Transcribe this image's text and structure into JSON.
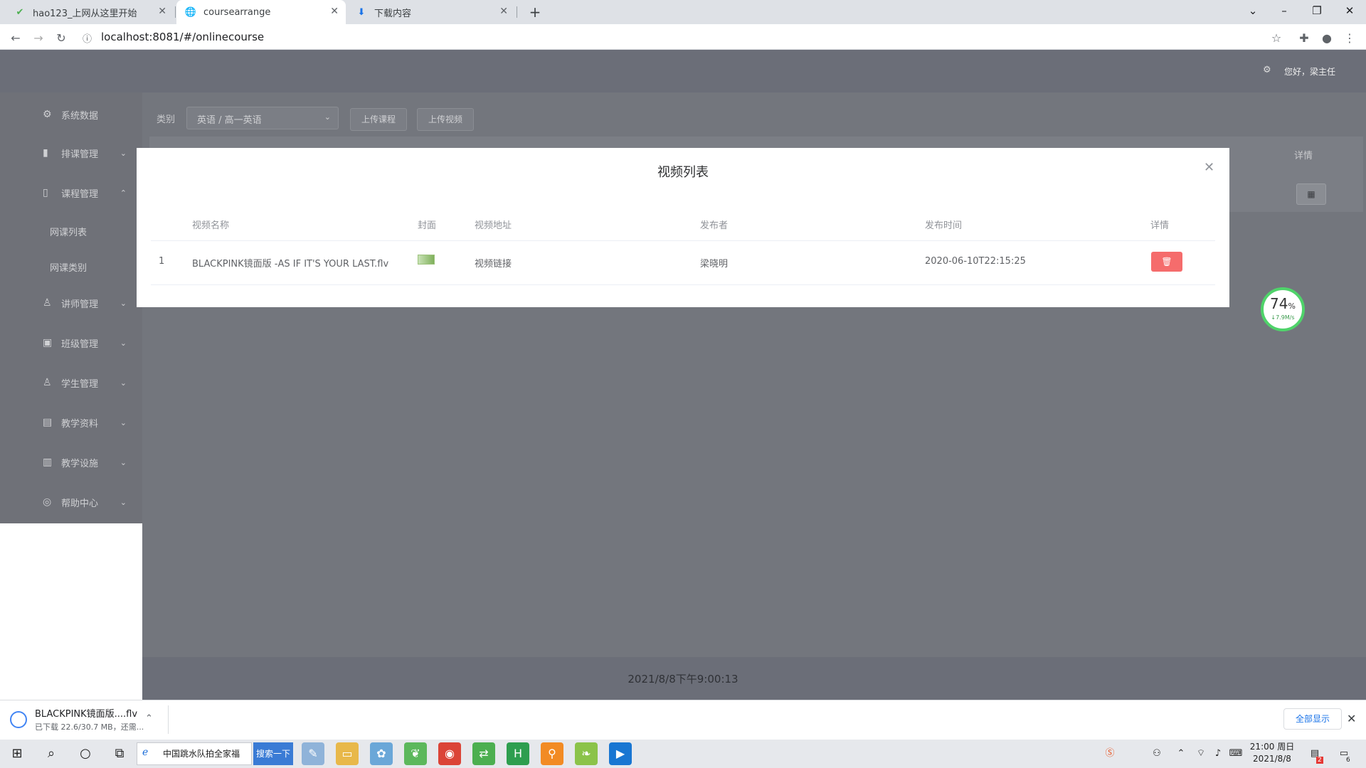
{
  "browser": {
    "tabs": [
      {
        "title": "hao123_上网从这里开始",
        "icon": "hao123-icon"
      },
      {
        "title": "coursearrange",
        "icon": "globe-icon"
      },
      {
        "title": "下载内容",
        "icon": "download-icon"
      }
    ],
    "url": "localhost:8081/#/onlinecourse"
  },
  "header": {
    "greeting": "您好，梁主任"
  },
  "sidebar": {
    "items": [
      {
        "label": "系统数据",
        "icon": "gear-icon"
      },
      {
        "label": "排课管理",
        "icon": "bar-chart-icon"
      },
      {
        "label": "课程管理",
        "icon": "book-icon"
      },
      {
        "label": "讲师管理",
        "icon": "user-icon"
      },
      {
        "label": "班级管理",
        "icon": "briefcase-icon"
      },
      {
        "label": "学生管理",
        "icon": "user-icon"
      },
      {
        "label": "教学资料",
        "icon": "document-icon"
      },
      {
        "label": "教学设施",
        "icon": "building-icon"
      },
      {
        "label": "帮助中心",
        "icon": "help-icon"
      }
    ],
    "sub_items": [
      {
        "label": "网课列表"
      },
      {
        "label": "网课类别"
      }
    ]
  },
  "toolbar": {
    "category_label": "类别",
    "category_value": "英语 / 高一英语",
    "upload_course": "上传课程",
    "upload_video": "上传视频"
  },
  "bg_table": {
    "detail_header": "详情"
  },
  "modal": {
    "title": "视频列表",
    "columns": [
      "视频名称",
      "封面",
      "视频地址",
      "发布者",
      "发布时间",
      "详情"
    ],
    "rows": [
      {
        "index": "1",
        "name": "BLACKPINK镜面版 -AS IF IT'S YOUR LAST.flv",
        "link": "视频链接",
        "publisher": "梁晓明",
        "time": "2020-06-10T22:15:25"
      }
    ]
  },
  "speed_widget": {
    "percent": "74",
    "unit": "%",
    "rate": "↓7.9M/s"
  },
  "footer": {
    "datetime": "2021/8/8下午9:00:13"
  },
  "download_bar": {
    "filename": "BLACKPINK镜面版....flv",
    "status": "已下载 22.6/30.7 MB，还需...",
    "show_all": "全部显示"
  },
  "taskbar": {
    "search_text": "中国跳水队拍全家福",
    "search_button": "搜索一下",
    "time": "21:00 周日",
    "date": "2021/8/8",
    "notification_badge": "2",
    "action_center_badge": "6"
  }
}
